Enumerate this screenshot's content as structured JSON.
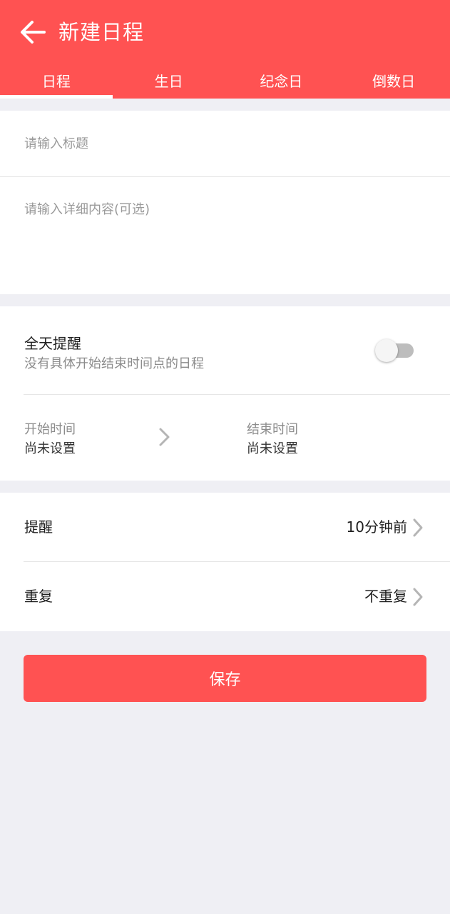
{
  "header": {
    "title": "新建日程",
    "back_icon": "arrow-left-icon",
    "background_color": "#ff5252"
  },
  "tabs": [
    {
      "label": "日程",
      "active": true
    },
    {
      "label": "生日",
      "active": false
    },
    {
      "label": "纪念日",
      "active": false
    },
    {
      "label": "倒数日",
      "active": false
    }
  ],
  "form": {
    "title_placeholder": "请输入标题",
    "title_value": "",
    "detail_placeholder": "请输入详细内容(可选)",
    "detail_value": ""
  },
  "all_day": {
    "title": "全天提醒",
    "subtitle": "没有具体开始结束时间点的日程",
    "enabled": false
  },
  "time": {
    "start_label": "开始时间",
    "start_value": "尚未设置",
    "end_label": "结束时间",
    "end_value": "尚未设置",
    "arrow_icon": "chevron-right-icon"
  },
  "settings": {
    "reminder_label": "提醒",
    "reminder_value": "10分钟前",
    "repeat_label": "重复",
    "repeat_value": "不重复"
  },
  "save_button": {
    "label": "保存",
    "color": "#ff5252"
  }
}
